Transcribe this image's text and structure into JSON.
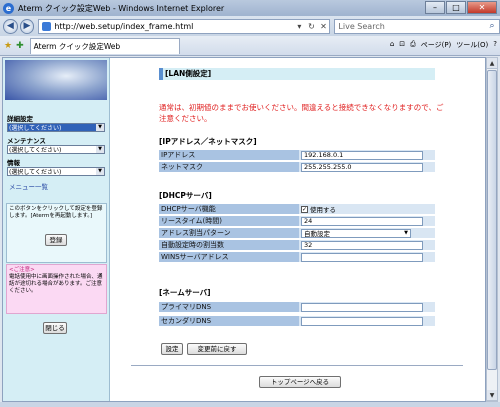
{
  "window": {
    "title": "Aterm クイック設定Web - Windows Internet Explorer",
    "min": "–",
    "max": "□",
    "close": "✕"
  },
  "address": {
    "url": "http://web.setup/index_frame.html",
    "search_placeholder": "Live Search",
    "back": "◀",
    "forward": "▶",
    "refresh": "↻",
    "stop": "✕",
    "dropdown": "▾",
    "search_btn": "⌕"
  },
  "tabs": {
    "active": "Aterm クイック設定Web",
    "fav_star": "★",
    "add_fav": "✚"
  },
  "toolbar": {
    "home": "⌂",
    "feeds": "⊡",
    "print": "⎙",
    "page": "ページ(P)",
    "tools": "ツール(O)",
    "help": "?"
  },
  "sidebar": {
    "menus": [
      {
        "label": "詳細設定",
        "value": "(選択してください)"
      },
      {
        "label": "メンテナンス",
        "value": "(選択してください)"
      },
      {
        "label": "情報",
        "value": "(選択してください)"
      }
    ],
    "menu_list_link": "メニュー一覧",
    "info_text": "このボタンをクリックして設定を登録します。[Atermを再起動します。]",
    "register_button": "登録",
    "caution_title": "<ご注意>",
    "caution_text": "電話使用中に画面操作された場合、通話が途切れる場合があります。ご注意ください。",
    "close_button": "閉じる"
  },
  "main": {
    "header": "[LAN側設定]",
    "warning": "通常は、初期値のままでお使いください。間違えると接続できなくなりますので、ご注意ください。",
    "ip_section": "[IPアドレス／ネットマスク]",
    "ip": {
      "label": "IPアドレス",
      "value": "192.168.0.1"
    },
    "mask": {
      "label": "ネットマスク",
      "value": "255.255.255.0"
    },
    "dhcp_section": "[DHCPサーバ]",
    "dhcp_func": {
      "label": "DHCPサーバ機能",
      "value": "使用する",
      "checked": "✓"
    },
    "lease": {
      "label": "リースタイム(時間)",
      "value": "24"
    },
    "pattern": {
      "label": "アドレス割当パターン",
      "value": "自動設定",
      "arrow": "▼"
    },
    "auto_count": {
      "label": "自動設定時の割当数",
      "value": "32"
    },
    "wins": {
      "label": "WINSサーバアドレス",
      "value": ""
    },
    "name_section": "[ネームサーバ]",
    "dns1": {
      "label": "プライマリDNS",
      "value": ""
    },
    "dns2": {
      "label": "セカンダリDNS",
      "value": ""
    },
    "set_button": "設定",
    "revert_button": "変更前に戻す",
    "top_button": "トップページへ戻る"
  },
  "scroll": {
    "up": "▲",
    "down": "▼"
  }
}
